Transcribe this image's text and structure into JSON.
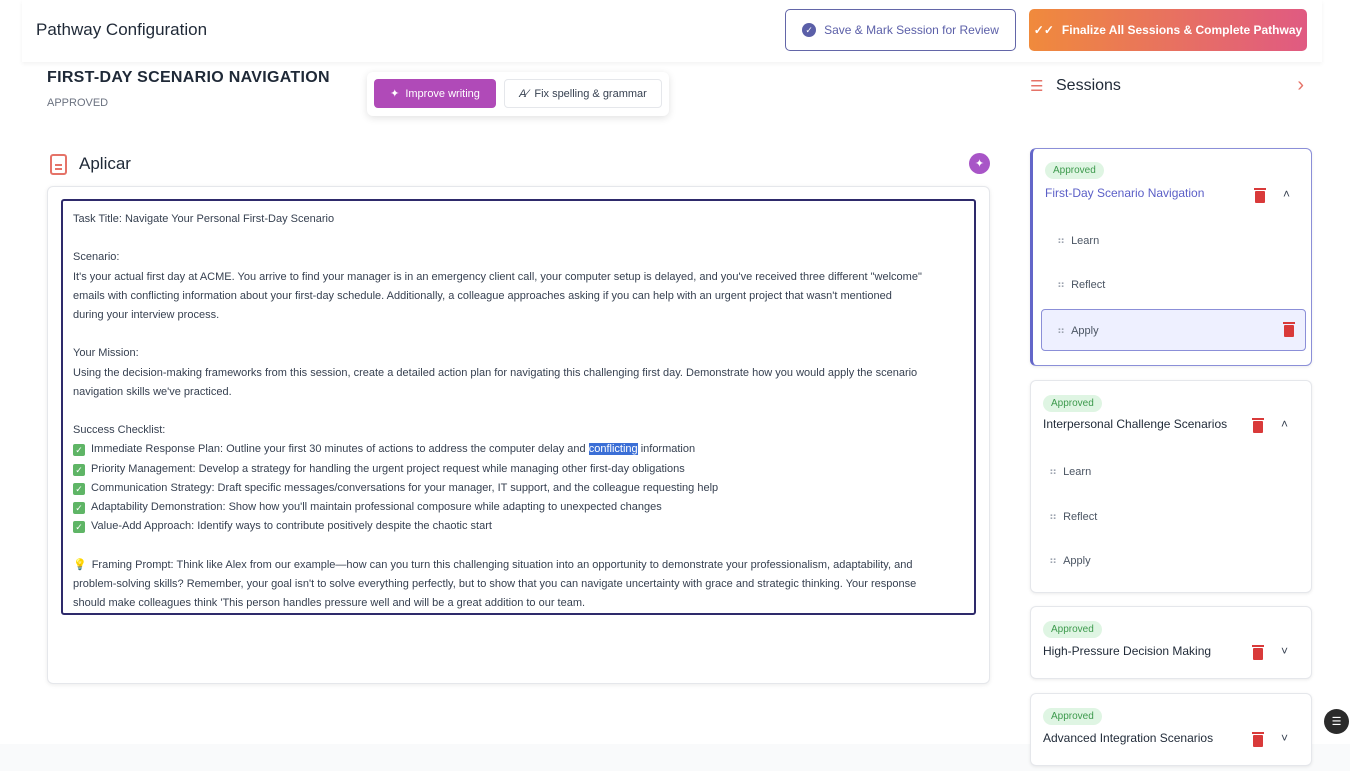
{
  "header": {
    "title": "Pathway Configuration",
    "save_review_label": "Save & Mark Session for Review",
    "finalize_label": "Finalize All Sessions & Complete Pathway"
  },
  "session": {
    "title": "FIRST-DAY SCENARIO NAVIGATION",
    "status": "APPROVED"
  },
  "ai_toolbar": {
    "improve_label": "Improve writing",
    "fix_label": "Fix spelling & grammar"
  },
  "section": {
    "label": "Aplicar"
  },
  "editor": {
    "lines": [
      "Task Title: Navigate Your Personal First-Day Scenario",
      "",
      "Scenario:",
      "It's your actual first day at ACME. You arrive to find your manager is in an emergency client call, your computer setup is delayed, and you've received three different \"welcome\"",
      "emails with conflicting information about your first-day schedule. Additionally, a colleague approaches asking if you can help with an urgent project that wasn't mentioned",
      "during your interview process.",
      "",
      "Your Mission:",
      "Using the decision-making frameworks from this session, create a detailed action plan for navigating this challenging first day. Demonstrate how you would apply the scenario",
      "navigation skills we've practiced.",
      "",
      "Success Checklist:"
    ],
    "checklist_first_pre": "Immediate Response Plan: Outline your first 30 minutes of actions to address the computer delay and ",
    "checklist_first_sel": "conflicting",
    "checklist_first_post": " information",
    "checklist": [
      "Priority Management: Develop a strategy for handling the urgent project request while managing other first-day obligations",
      "Communication Strategy: Draft specific messages/conversations for your manager, IT support, and the colleague requesting help",
      "Adaptability Demonstration: Show how you'll maintain professional composure while adapting to unexpected changes",
      "Value-Add Approach: Identify ways to contribute positively despite the chaotic start"
    ],
    "framing": [
      "Framing Prompt: Think like Alex from our example—how can you turn this challenging situation into an opportunity to demonstrate your professionalism, adaptability, and",
      "problem-solving skills? Remember, your goal isn't to solve everything perfectly, but to show that you can navigate uncertainty with grace and strategic thinking. Your response",
      "should make colleagues think 'This person handles pressure well and will be a great addition to our team."
    ]
  },
  "sidebar": {
    "title": "Sessions",
    "sessions": [
      {
        "badge": "Approved",
        "title": "First-Day Scenario Navigation",
        "items": [
          "Learn",
          "Reflect",
          "Apply"
        ]
      },
      {
        "badge": "Approved",
        "title": "Interpersonal Challenge Scenarios",
        "items": [
          "Learn",
          "Reflect",
          "Apply"
        ]
      },
      {
        "badge": "Approved",
        "title": "High-Pressure Decision Making"
      },
      {
        "badge": "Approved",
        "title": "Advanced Integration Scenarios"
      }
    ]
  },
  "icons": {
    "check_icon": "✓",
    "sparkle_icon": "✦",
    "chevron_right_icon": "›",
    "chevron_up_icon": "˄",
    "chevron_down_icon": "˅",
    "grip_icon": "⠶",
    "bulb_icon": "💡"
  },
  "colors": {
    "accent": "#5b5fc7",
    "finalize_gradient_start": "#f08a3c",
    "finalize_gradient_end": "#e05a82",
    "approved_badge": "#3d9a4d",
    "delete": "#d93a3a"
  }
}
